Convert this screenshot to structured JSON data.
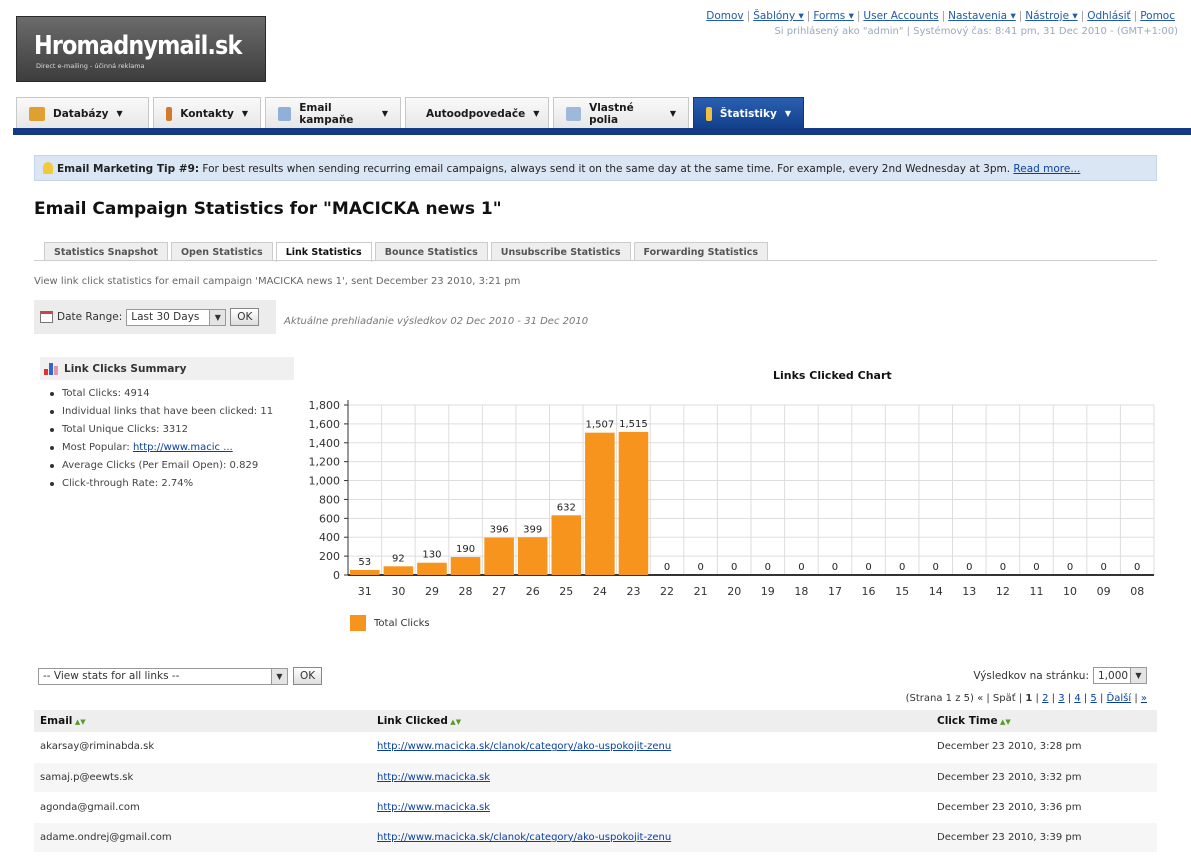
{
  "header": {
    "logo_title": "Hromadnymail.sk",
    "logo_subtitle": "Direct e-mailing - účinná reklama",
    "links": [
      "Domov",
      "Šablóny ▾",
      "Forms ▾",
      "User Accounts",
      "Nastavenia ▾",
      "Nástroje ▾",
      "Odhlásiť",
      "Pomoc"
    ],
    "status": "Si prihlásený ako \"admin\" | Systémový čas: 8:41 pm, 31 Dec 2010 - (GMT+1:00)"
  },
  "nav": {
    "tabs": [
      {
        "label": "Databázy",
        "icon": "database-icon",
        "color": "#e0a030"
      },
      {
        "label": "Kontakty",
        "icon": "contacts-icon",
        "color": "#d07a30"
      },
      {
        "label": "Email kampaňe",
        "icon": "envelope-icon",
        "color": "#8fb0d8"
      },
      {
        "label": "Autoodpovedače",
        "icon": "autoresponder-icon",
        "color": "#5b9a3a"
      },
      {
        "label": "Vlastné polia",
        "icon": "fields-icon",
        "color": "#9fb7d8"
      },
      {
        "label": "Štatistiky",
        "icon": "stats-icon",
        "color": "#f0c040"
      }
    ]
  },
  "tip": {
    "title": "Email Marketing Tip #9:",
    "text": " For best results when sending recurring email campaigns, always send it on the same day at the same time. For example, every 2nd Wednesday at 3pm. ",
    "link": "Read more..."
  },
  "page_title": "Email Campaign Statistics for \"MACICKA news 1\"",
  "stat_tabs": [
    "Statistics Snapshot",
    "Open Statistics",
    "Link Statistics",
    "Bounce Statistics",
    "Unsubscribe Statistics",
    "Forwarding Statistics"
  ],
  "description": "View link click statistics for email campaign 'MACICKA news 1', sent December 23 2010, 3:21 pm",
  "date_range": {
    "label": "Date Range:",
    "value": "Last 30 Days",
    "button": "OK",
    "note": "Aktuálne prehliadanie výsledkov 02 Dec 2010 - 31 Dec 2010"
  },
  "summary": {
    "title": "Link Clicks Summary",
    "items": [
      {
        "text": "Total Clicks: 4914"
      },
      {
        "text": "Individual links that have been clicked: 11"
      },
      {
        "text": "Total Unique Clicks: 3312"
      },
      {
        "text": "Most Popular: ",
        "link": "http://www.macic ..."
      },
      {
        "text": "Average Clicks (Per Email Open): 0.829"
      },
      {
        "text": "Click-through Rate: 2.74%"
      }
    ]
  },
  "chart_data": {
    "type": "bar",
    "title": "Links Clicked Chart",
    "categories": [
      "31",
      "30",
      "29",
      "28",
      "27",
      "26",
      "25",
      "24",
      "23",
      "22",
      "21",
      "20",
      "19",
      "18",
      "17",
      "16",
      "15",
      "14",
      "13",
      "12",
      "11",
      "10",
      "09",
      "08"
    ],
    "series": [
      {
        "name": "Total Clicks",
        "values": [
          53,
          92,
          130,
          190,
          396,
          399,
          632,
          1507,
          1515,
          0,
          0,
          0,
          0,
          0,
          0,
          0,
          0,
          0,
          0,
          0,
          0,
          0,
          0,
          0
        ],
        "color": "#f7941d"
      }
    ],
    "ylim": [
      0,
      1800
    ],
    "yticks": [
      "0",
      "200",
      "400",
      "600",
      "800",
      "1,000",
      "1,200",
      "1,400",
      "1,600",
      "1,800"
    ],
    "grid": true,
    "legend": "bottom-left"
  },
  "filter": {
    "value": "-- View stats for all links --",
    "button": "OK"
  },
  "per_page": {
    "label": "Výsledkov na stránku:",
    "value": "1,000"
  },
  "pager": {
    "prefix": "(Strana 1 z 5)  « | Späť | ",
    "current": "1",
    "pages": [
      "2",
      "3",
      "4",
      "5"
    ],
    "next": "Ďalší",
    "last": "»"
  },
  "table": {
    "headers": [
      "Email",
      "Link Clicked",
      "Click Time"
    ],
    "rows": [
      [
        "akarsay@riminabda.sk",
        "http://www.macicka.sk/clanok/category/ako-uspokojit-zenu",
        "December 23 2010, 3:28 pm"
      ],
      [
        "samaj.p@eewts.sk",
        "http://www.macicka.sk",
        "December 23 2010, 3:32 pm"
      ],
      [
        "agonda@gmail.com",
        "http://www.macicka.sk",
        "December 23 2010, 3:36 pm"
      ],
      [
        "adame.ondrej@gmail.com",
        "http://www.macicka.sk/clanok/category/ako-uspokojit-zenu",
        "December 23 2010, 3:39 pm"
      ]
    ]
  }
}
